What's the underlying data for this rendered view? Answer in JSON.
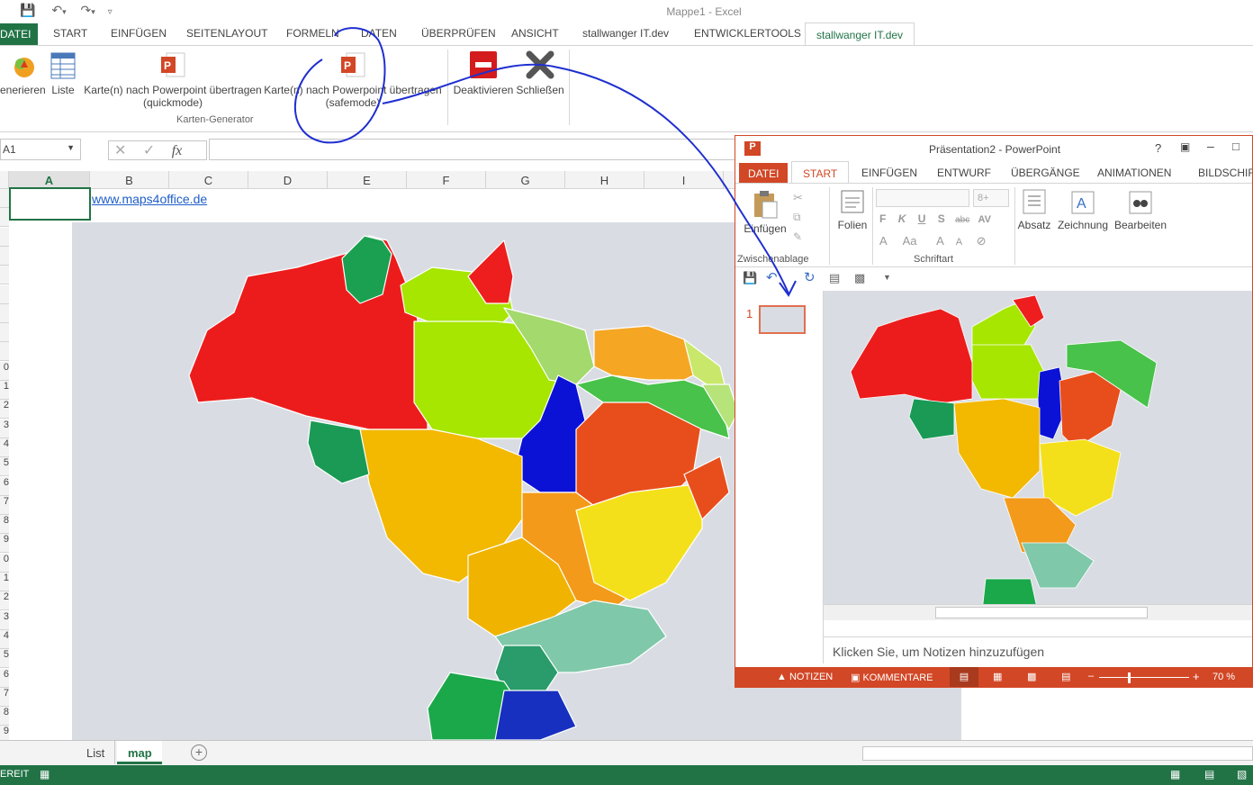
{
  "excel": {
    "title": "Mappe1 - Excel",
    "tabs": [
      "DATEI",
      "START",
      "EINFÜGEN",
      "SEITENLAYOUT",
      "FORMELN",
      "DATEN",
      "ÜBERPRÜFEN",
      "ANSICHT",
      "stallwanger IT.dev",
      "ENTWICKLERTOOLS",
      "stallwanger IT.dev"
    ],
    "ribbon": {
      "btn_generate": "enerieren",
      "btn_list": "Liste",
      "btn_quick_l1": "Karte(n) nach Powerpoint übertragen",
      "btn_quick_l2": "(quickmode)",
      "btn_safe_l1": "Karte(n) nach Powerpoint übertragen",
      "btn_safe_l2": "(safemode)",
      "btn_deactivate": "Deaktivieren",
      "btn_close": "Schließen",
      "group_label": "Karten-Generator"
    },
    "namebox": "A1",
    "fx": "fx",
    "columns": [
      "A",
      "B",
      "C",
      "D",
      "E",
      "F",
      "G",
      "H",
      "I"
    ],
    "rows": [
      "",
      "",
      "",
      "",
      "",
      "",
      "",
      "",
      "",
      "0",
      "1",
      "2",
      "3",
      "4",
      "5",
      "6",
      "7",
      "8",
      "9",
      "0",
      "1",
      "2",
      "3",
      "4",
      "5",
      "6",
      "7",
      "8",
      "9"
    ],
    "link": "www.maps4office.de",
    "sheets": [
      "List",
      "map"
    ],
    "status_left": "EREIT"
  },
  "ppt": {
    "title": "Präsentation2 - PowerPoint",
    "tabs": [
      "DATEI",
      "START",
      "EINFÜGEN",
      "ENTWURF",
      "ÜBERGÄNGE",
      "ANIMATIONEN",
      "BILDSCHIRM"
    ],
    "ribbon": {
      "paste": "Einfügen",
      "clipboard": "Zwischenablage",
      "slides": "Folien",
      "font_group": "Schriftart",
      "font_size": "8+",
      "paragraph": "Absatz",
      "drawing": "Zeichnung",
      "editing": "Bearbeiten"
    },
    "slide_number": "1",
    "notes_placeholder": "Klicken Sie, um Notizen hinzuzufügen",
    "status": {
      "notes": "NOTIZEN",
      "comments": "KOMMENTARE",
      "zoom": "70 %"
    }
  },
  "colors": {
    "excel_green": "#217346",
    "ppt_orange": "#d24726",
    "annotation_blue": "#1f2fd0"
  }
}
